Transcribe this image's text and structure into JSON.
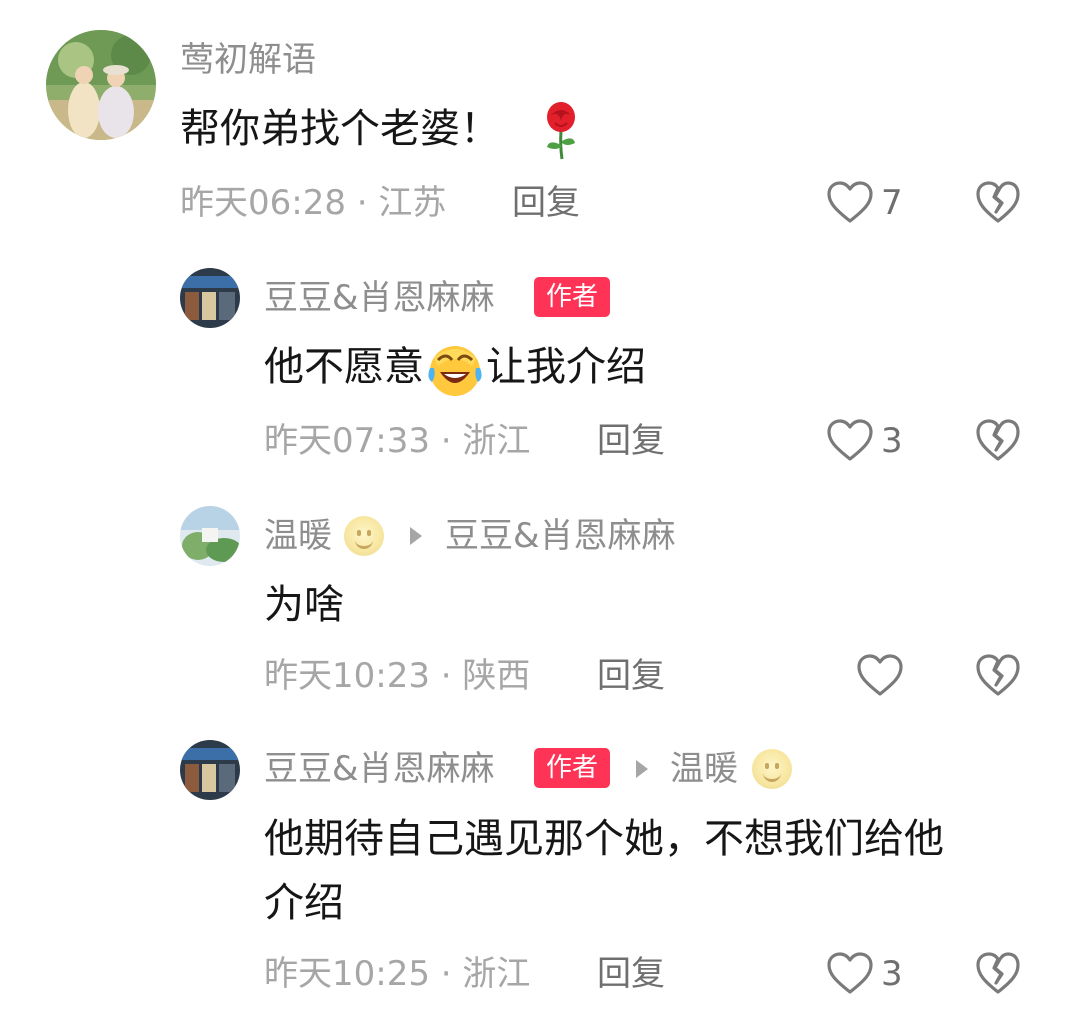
{
  "comments": [
    {
      "username": "莺初解语",
      "text": "帮你弟找个老婆！",
      "emoji": "rose-emoji",
      "time": "昨天06:28",
      "location": "江苏",
      "reply_label": "回复",
      "likes": "7"
    },
    {
      "username": "豆豆&肖恩麻麻",
      "badge": "作者",
      "text_before": "他不愿意",
      "emoji": "laugh-cry-emoji",
      "text_after": "让我介绍",
      "time": "昨天07:33",
      "location": "浙江",
      "reply_label": "回复",
      "likes": "3"
    },
    {
      "username": "温暖",
      "emoji": "smile-emoji",
      "reply_to": "豆豆&肖恩麻麻",
      "text": "为啥",
      "time": "昨天10:23",
      "location": "陕西",
      "reply_label": "回复",
      "likes": ""
    },
    {
      "username": "豆豆&肖恩麻麻",
      "badge": "作者",
      "reply_to": "温暖",
      "text_line1": "他期待自己遇见那个她，不想我们给他",
      "text_line2": "介绍",
      "time": "昨天10:25",
      "location": "浙江",
      "reply_label": "回复",
      "likes": "3"
    }
  ],
  "separator": " · ",
  "colors": {
    "badge": "#ff3355",
    "secondary_text": "#a6a6a6",
    "username": "#8e8e8e"
  },
  "icons": {
    "like": "heart-outline-icon",
    "dislike": "broken-heart-icon"
  }
}
